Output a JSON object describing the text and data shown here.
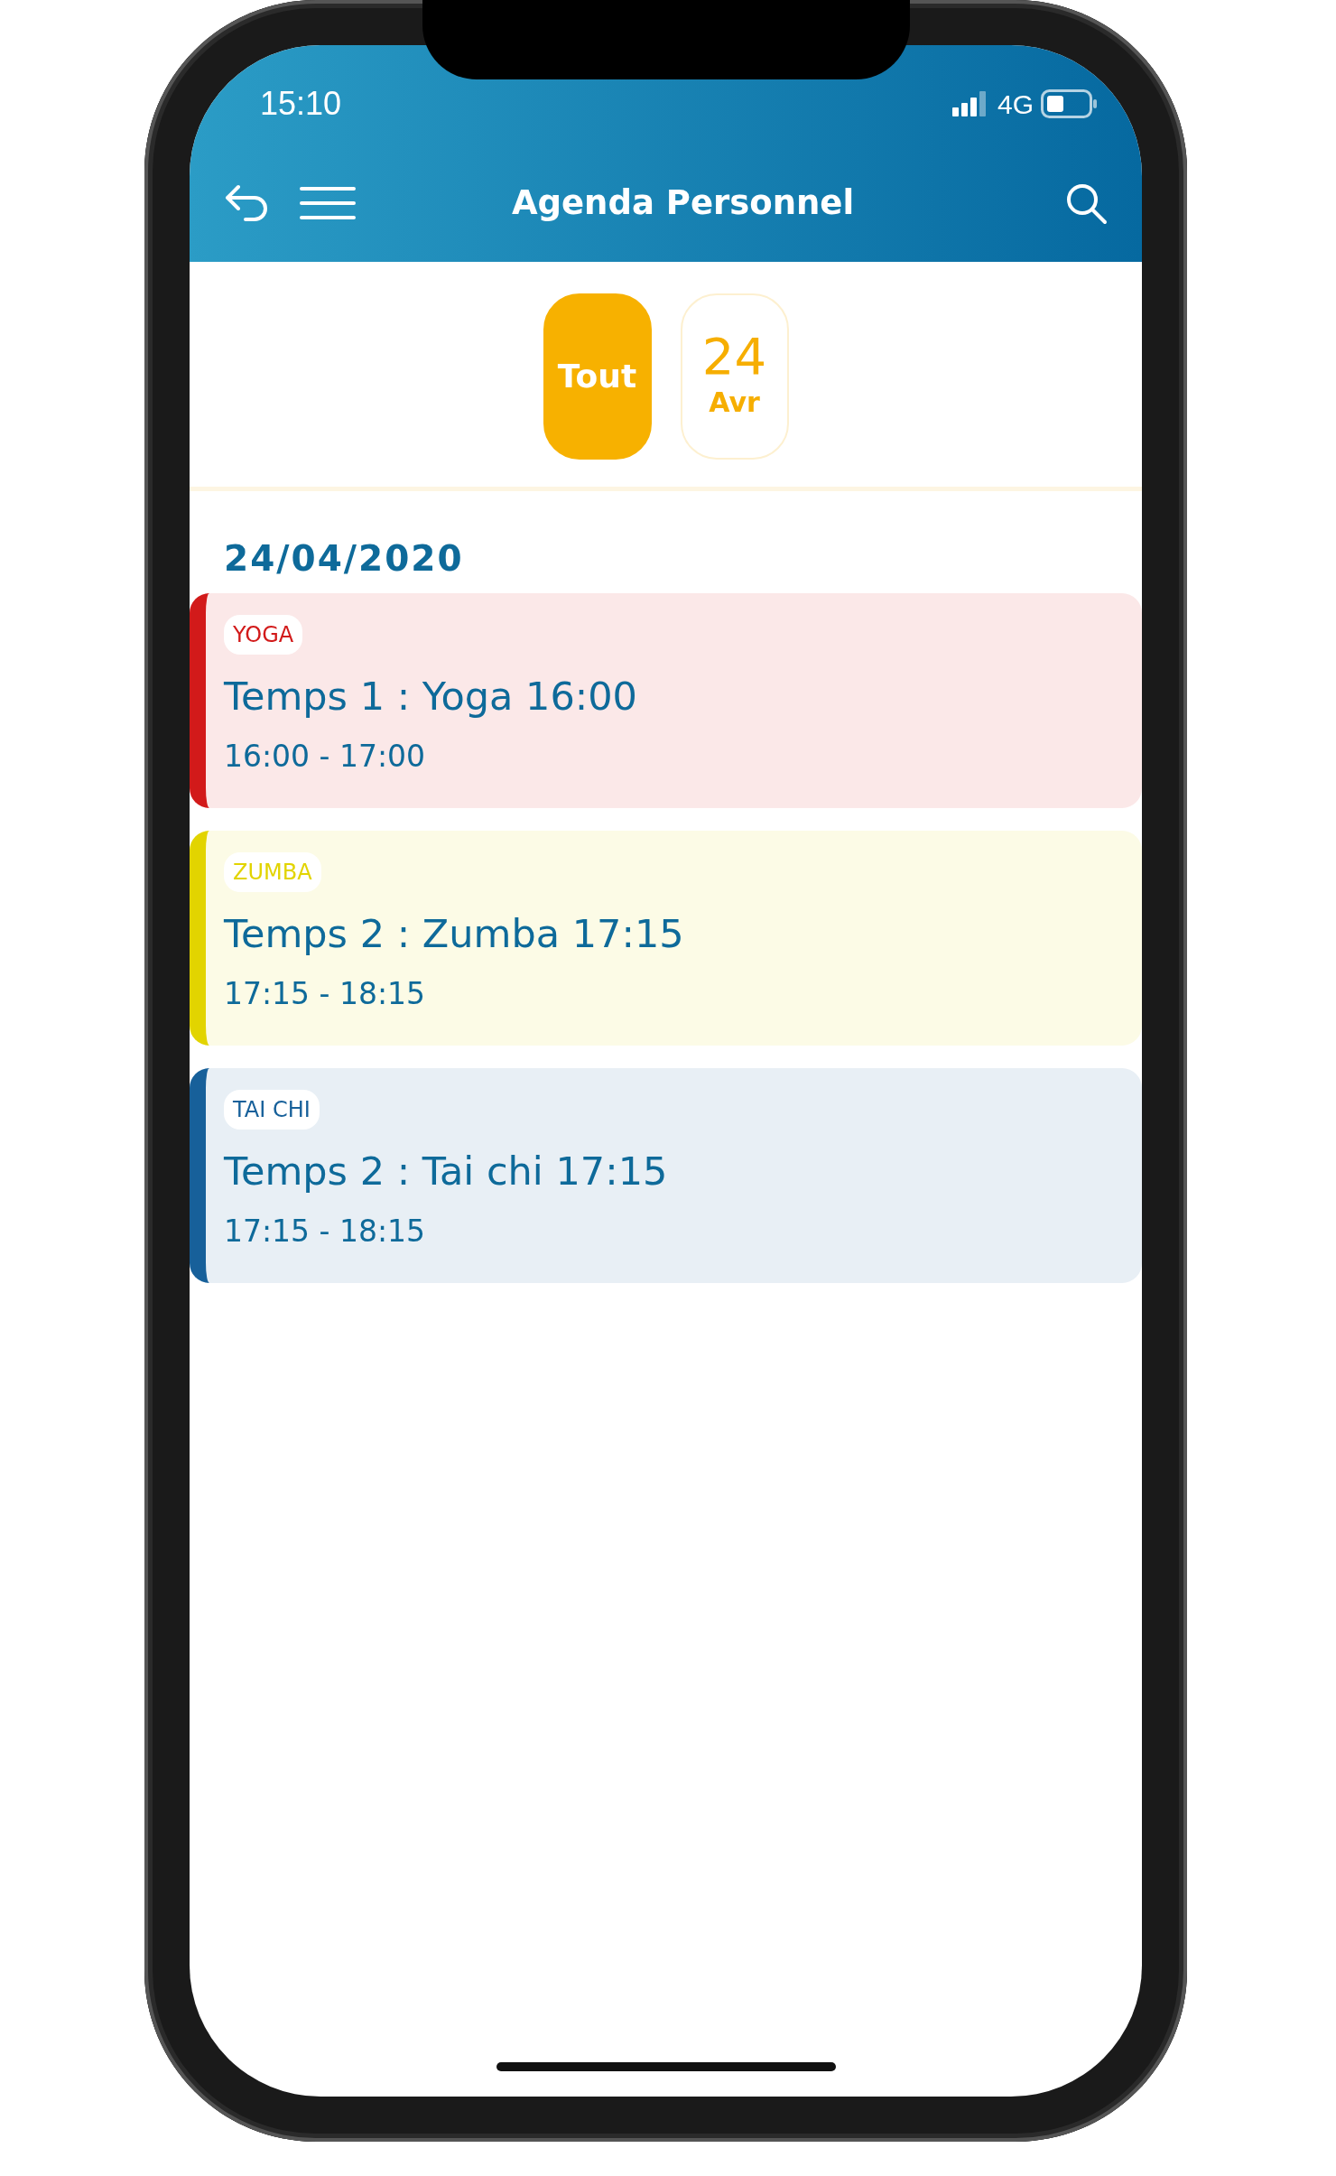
{
  "status_bar": {
    "time": "15:10",
    "network": "4G"
  },
  "header": {
    "title": "Agenda Personnel"
  },
  "filters": [
    {
      "kind": "all",
      "label": "Tout",
      "selected": true
    },
    {
      "kind": "day",
      "day": "24",
      "month": "Avr",
      "selected": false
    }
  ],
  "date_heading": "24/04/2020",
  "events": [
    {
      "tag": "YOGA",
      "title": "Temps 1 : Yoga 16:00",
      "time": "16:00 - 17:00",
      "color": "#d21a1a"
    },
    {
      "tag": "ZUMBA",
      "title": "Temps 2 : Zumba 17:15",
      "time": "17:15 - 18:15",
      "color": "#e2d400"
    },
    {
      "tag": "TAI CHI",
      "title": "Temps 2 : Tai chi 17:15",
      "time": "17:15 - 18:15",
      "color": "#17609a"
    }
  ]
}
